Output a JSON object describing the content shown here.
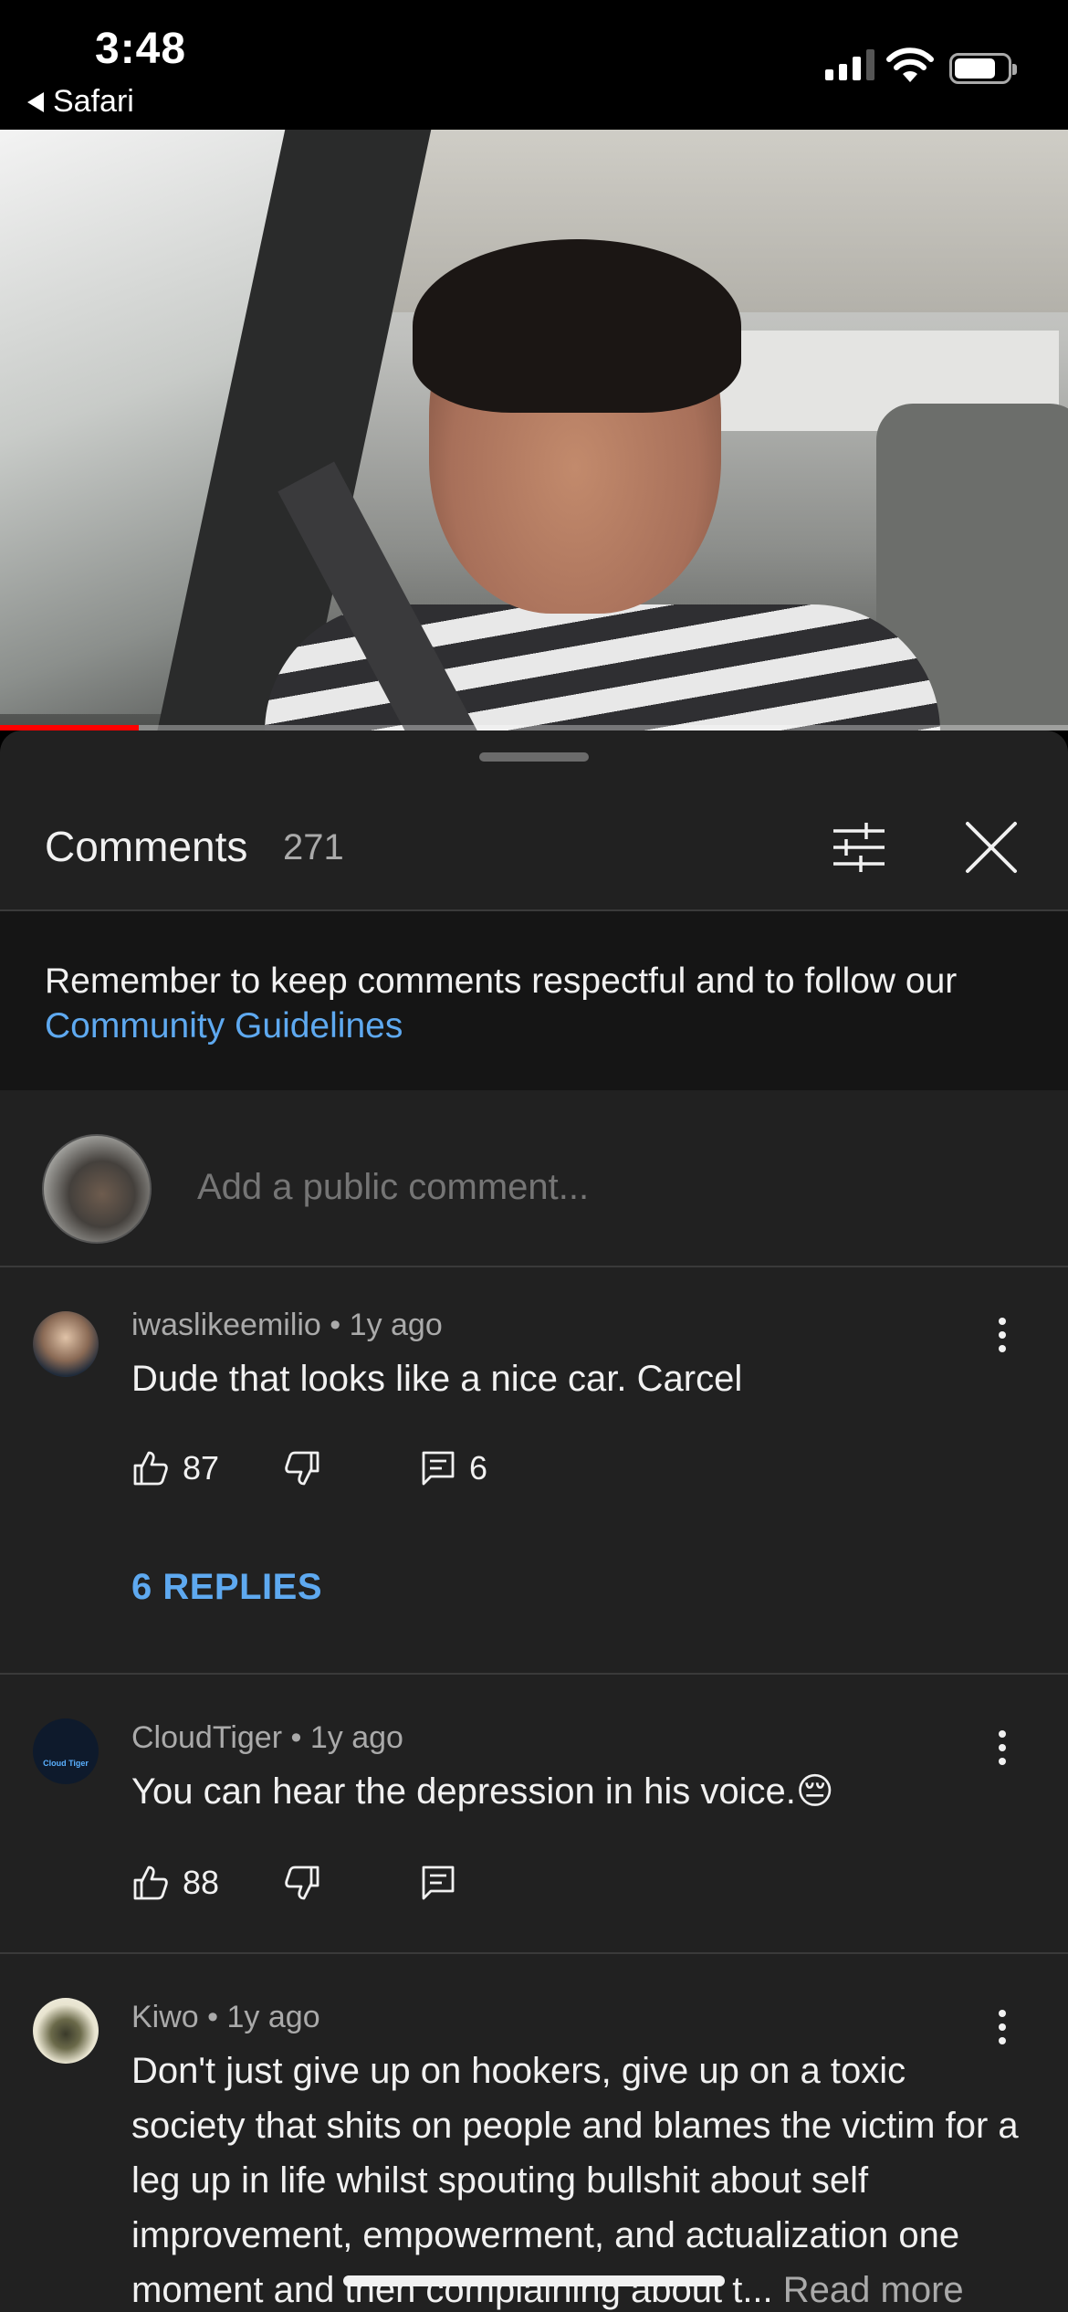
{
  "status_bar": {
    "time": "3:48",
    "back_app": "Safari"
  },
  "video": {
    "progress_fraction": 0.13
  },
  "comments_sheet": {
    "title": "Comments",
    "count": "271",
    "notice_text": "Remember to keep comments respectful and to follow our ",
    "notice_link": "Community Guidelines",
    "add_comment_placeholder": "Add a public comment...",
    "comments": [
      {
        "author": "iwaslikeemilio",
        "age": "1y ago",
        "text": "Dude that looks like a nice car. Carcel",
        "likes": "87",
        "reply_count": "6",
        "replies_label": "6 REPLIES"
      },
      {
        "author": "CloudTiger",
        "age": "1y ago",
        "text": "You can hear the depression in his voice.",
        "emoji": "😔",
        "likes": "88",
        "avatar_text": "Cloud Tiger"
      },
      {
        "author": "Kiwo",
        "age": "1y ago",
        "text": "Don't just give up on hookers, give up on a toxic society that shits on people and blames the victim for a leg up in life whilst spouting bullshit about self improvement, empowerment, and actualization one moment and then complaining about t...",
        "read_more": "Read more"
      }
    ]
  },
  "colors": {
    "accent_link": "#5ea9f0",
    "progress": "#ff0000",
    "sheet_bg": "#212121"
  }
}
